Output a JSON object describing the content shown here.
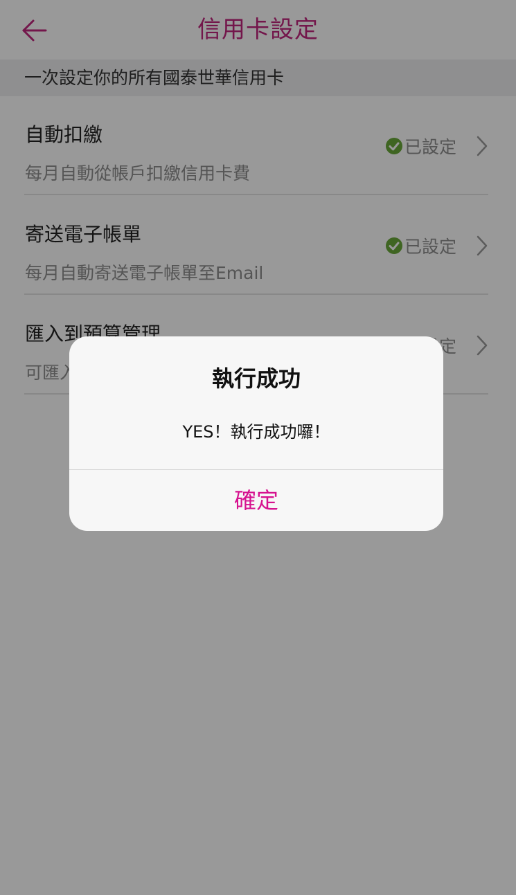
{
  "header": {
    "title": "信用卡設定"
  },
  "section": {
    "description": "一次設定你的所有國泰世華信用卡"
  },
  "rows": [
    {
      "title": "自動扣繳",
      "subtitle": "每月自動從帳戶扣繳信用卡費",
      "status": "已設定",
      "status_icon": "check-circle-icon"
    },
    {
      "title": "寄送電子帳單",
      "subtitle": "每月自動寄送電子帳單至Email",
      "status": "已設定",
      "status_icon": "check-circle-icon"
    },
    {
      "title": "匯入到預算管理",
      "subtitle": "可匯入",
      "status": "已設定",
      "status_icon": "check-circle-icon"
    }
  ],
  "dialog": {
    "title": "執行成功",
    "message": "YES！執行成功囉！",
    "confirm_label": "確定"
  },
  "colors": {
    "brand": "#c0267e",
    "confirm": "#d6128f",
    "check_green": "#6aa83a"
  }
}
